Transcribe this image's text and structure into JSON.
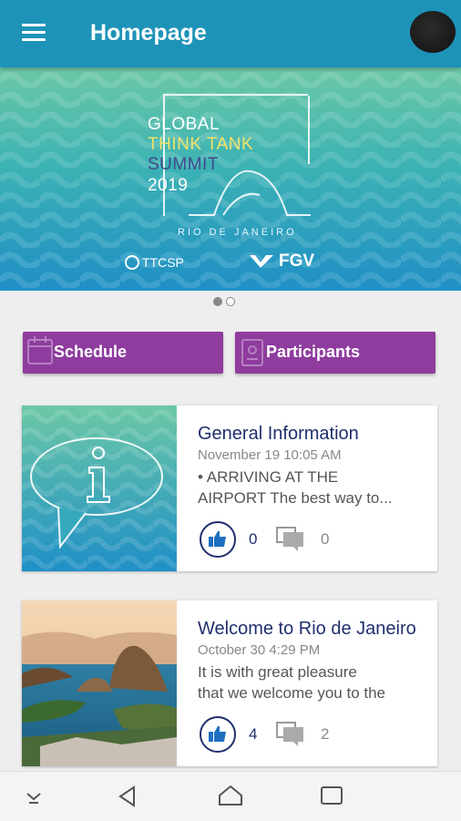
{
  "app_bar": {
    "title": "Homepage",
    "menu_icon": "hamburger-menu-icon",
    "avatar": "user-avatar"
  },
  "banner": {
    "line1": "GLOBAL",
    "line2": "THINK TANK",
    "line3": "SUMMIT",
    "line4": "2019",
    "city": "RIO DE JANEIRO",
    "partner1": "TTCSP",
    "partner2": "FGV",
    "colors": {
      "top": "#6cc8a6",
      "bottom": "#1f8fc6",
      "think_tank": "#f0e26a",
      "summit": "#404a8c"
    }
  },
  "carousel": {
    "total": 2,
    "active": 1
  },
  "buttons": {
    "schedule": "Schedule",
    "participants": "Participants",
    "color": "#8e3c9e"
  },
  "cards": [
    {
      "title": "General Information",
      "date": "November 19 10:05 AM",
      "line1": "• ARRIVING AT THE",
      "line2": "AIRPORT The best way to...",
      "likes": "0",
      "comments": "0",
      "icon": "info-speech-bubble-icon"
    },
    {
      "title": "Welcome to Rio de Janeiro",
      "date": "October 30 4:29 PM",
      "line1": "It is with great pleasure",
      "line2": "that we welcome you to the",
      "likes": "4",
      "comments": "2",
      "image": "rio-sugarloaf-photo"
    }
  ],
  "system_nav": [
    "collapse-icon",
    "back-icon",
    "home-icon",
    "recents-icon"
  ]
}
